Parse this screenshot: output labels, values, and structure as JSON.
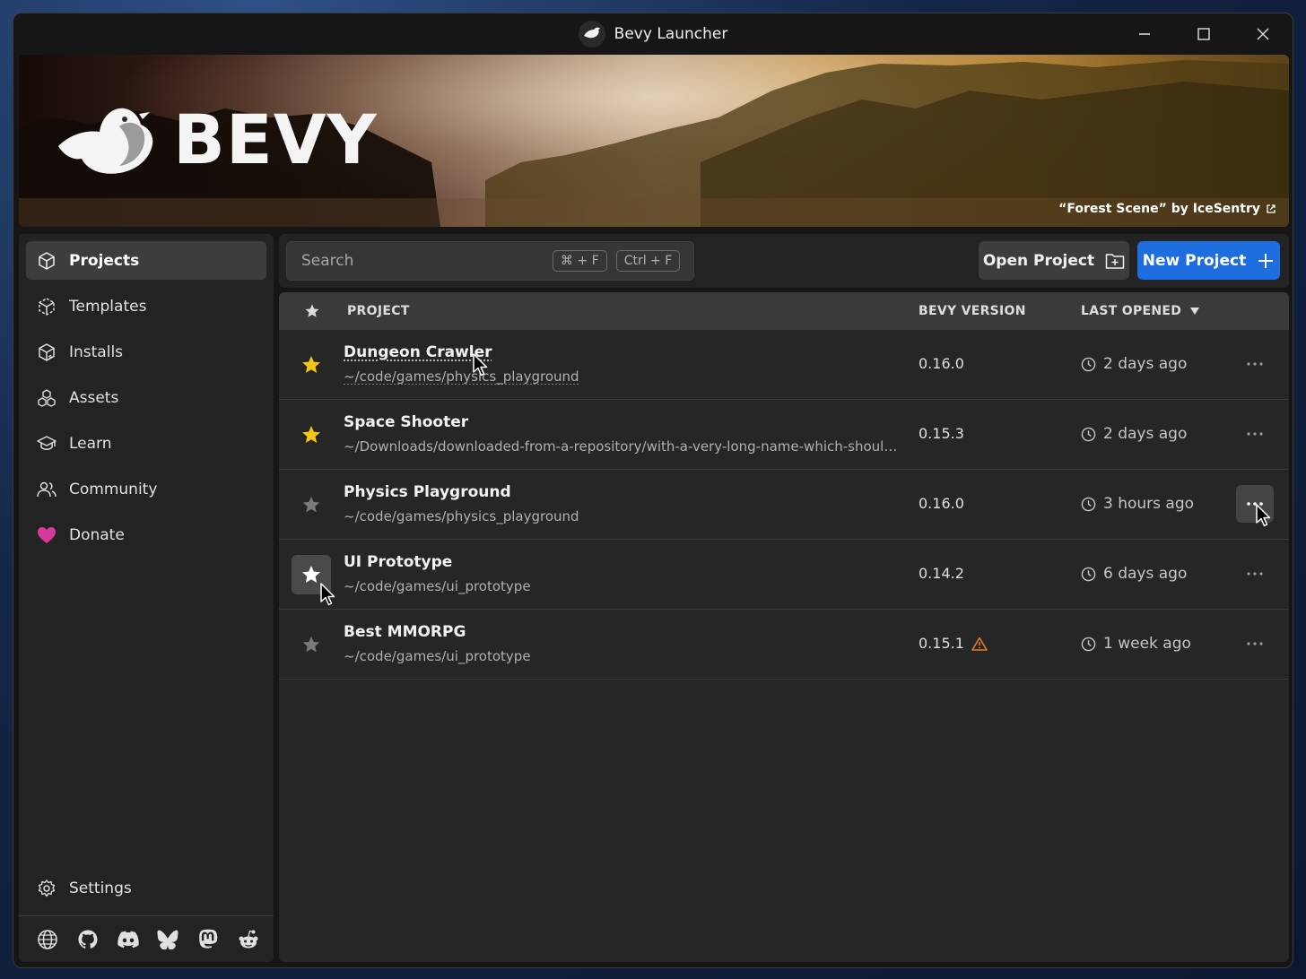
{
  "window": {
    "title": "Bevy Launcher"
  },
  "banner": {
    "brand": "BEVY",
    "credit": "“Forest Scene” by IceSentry"
  },
  "sidebar": {
    "items": [
      {
        "label": "Projects",
        "icon": "cube-icon",
        "active": true
      },
      {
        "label": "Templates",
        "icon": "template-icon"
      },
      {
        "label": "Installs",
        "icon": "package-icon"
      },
      {
        "label": "Assets",
        "icon": "assets-icon"
      },
      {
        "label": "Learn",
        "icon": "graduation-cap-icon"
      },
      {
        "label": "Community",
        "icon": "users-icon"
      },
      {
        "label": "Donate",
        "icon": "heart-icon",
        "color": "#d53a9d"
      }
    ],
    "settings_label": "Settings",
    "socials": [
      "globe-icon",
      "github-icon",
      "discord-icon",
      "bluesky-icon",
      "mastodon-icon",
      "reddit-icon"
    ]
  },
  "toolbar": {
    "search_placeholder": "Search",
    "shortcut_mac": "⌘ + F",
    "shortcut_win": "Ctrl + F",
    "open_label": "Open Project",
    "new_label": "New Project"
  },
  "table": {
    "headers": {
      "project": "PROJECT",
      "version": "BEVY VERSION",
      "last_opened": "LAST OPENED"
    },
    "sort": "last_opened-descending",
    "rows": [
      {
        "name": "Dungeon Crawler",
        "path": "~/code/games/physics_playground",
        "version": "0.16.0",
        "last_opened": "2 days ago",
        "starred": true
      },
      {
        "name": "Space Shooter",
        "path": "~/Downloads/downloaded-from-a-repository/with-a-very-long-name-which-should-be-truncated",
        "version": "0.15.3",
        "last_opened": "2 days ago",
        "starred": true
      },
      {
        "name": "Physics Playground",
        "path": "~/code/games/physics_playground",
        "version": "0.16.0",
        "last_opened": "3 hours ago",
        "starred": false
      },
      {
        "name": "UI Prototype",
        "path": "~/code/games/ui_prototype",
        "version": "0.14.2",
        "last_opened": "6 days ago",
        "starred": false
      },
      {
        "name": "Best MMORPG",
        "path": "~/code/games/ui_prototype",
        "version": "0.15.1",
        "last_opened": "1 week ago",
        "starred": false,
        "warning": true
      }
    ]
  },
  "colors": {
    "accent": "#1f6ee0",
    "star": "#f5c518",
    "warning": "#e8812c",
    "donate": "#d53a9d"
  }
}
